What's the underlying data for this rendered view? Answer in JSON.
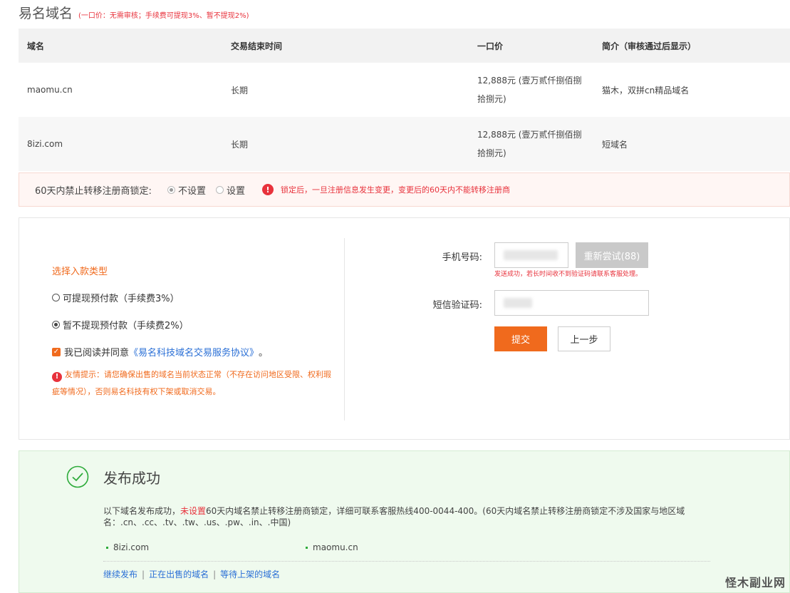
{
  "header": {
    "title": "易名域名",
    "note": "(一口价：无需审核；手续费可提现3%、暂不提现2%)"
  },
  "table": {
    "columns": [
      "域名",
      "交易结束时间",
      "一口价",
      "简介（审核通过后显示）"
    ],
    "rows": [
      {
        "domain": "maomu.cn",
        "end": "长期",
        "price": "12,888元 (壹万贰仟捌佰捌拾捌元)",
        "desc": "猫木，双拼cn精品域名"
      },
      {
        "domain": "8izi.com",
        "end": "长期",
        "price": "12,888元 (壹万贰仟捌佰捌拾捌元)",
        "desc": "短域名"
      }
    ]
  },
  "lock": {
    "label": "60天内禁止转移注册商锁定:",
    "option_off": "不设置",
    "option_on": "设置",
    "selected": "不设置",
    "warning": "锁定后，一旦注册信息发生变更，变更后的60天内不能转移注册商"
  },
  "payment": {
    "title": "选择入款类型",
    "option1": "可提现预付款（手续费3%）",
    "option2": "暂不提现预付款（手续费2%）",
    "selected": "暂不提现预付款（手续费2%）",
    "agree_prefix": "我已阅读并同意",
    "agree_link": "《易名科技域名交易服务协议》",
    "agree_suffix": "。",
    "tip": "友情提示：请您确保出售的域名当前状态正常（不存在访问地区受限、权利瑕疵等情况），否则易名科技有权下架或取消交易。"
  },
  "verify": {
    "phone_label": "手机号码:",
    "retry_label": "重新尝试(88)",
    "send_note": "发送成功，若长时间收不到验证码请联系客服处理。",
    "sms_label": "短信验证码:",
    "submit_label": "提交",
    "back_label": "上一步"
  },
  "success": {
    "title": "发布成功",
    "desc_prefix": "以下域名发布成功，",
    "desc_red": "未设置",
    "desc_suffix": "60天内域名禁止转移注册商锁定，详细可联系客服热线400-0044-400。(60天内域名禁止转移注册商锁定不涉及国家与地区域名：.cn、.cc、.tv、.tw、.us、.pw、.in、.中国)",
    "domains": [
      "8izi.com",
      "maomu.cn"
    ],
    "link1": "继续发布",
    "link2": "正在出售的域名",
    "link3": "等待上架的域名"
  },
  "watermark": "怪木副业网",
  "colors": {
    "accent": "#f06a1d",
    "warning": "#e8323c",
    "success": "#2eab3b",
    "link": "#2a6fd6"
  }
}
